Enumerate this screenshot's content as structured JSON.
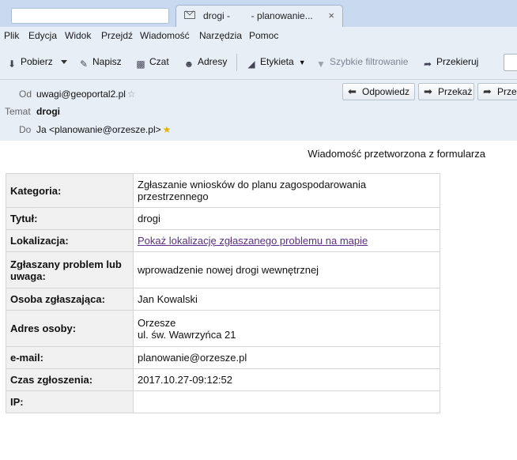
{
  "tab": {
    "title": "drogi -        - planowanie...",
    "close": "×"
  },
  "menu": [
    "Plik",
    "Edycja",
    "Widok",
    "Przejdź",
    "Wiadomość",
    "Narzędzia",
    "Pomoc"
  ],
  "toolbar": {
    "get": "Pobierz",
    "write": "Napisz",
    "chat": "Czat",
    "contacts": "Adresy",
    "tag": "Etykieta",
    "quickfilter": "Szybkie filtrowanie",
    "redirect": "Przekieruj"
  },
  "header": {
    "from_label": "Od",
    "from": "uwagi@geoportal2.pl",
    "subject_label": "Temat",
    "subject": "drogi",
    "to_label": "Do",
    "to": "Ja <planowanie@orzesze.pl>",
    "reply": "Odpowiedz",
    "forward": "Przekaż",
    "more": "Przek"
  },
  "message": {
    "caption": "Wiadomość przetworzona z formularza",
    "rows": [
      {
        "key": "Kategoria:",
        "value": "Zgłaszanie wniosków do planu zagospodarowania przestrzennego"
      },
      {
        "key": "Tytuł:",
        "value": "drogi"
      },
      {
        "key": "Lokalizacja:",
        "value": "Pokaż lokalizację zgłaszanego problemu na mapie",
        "link": true
      },
      {
        "key": "Zgłaszany problem lub uwaga:",
        "value": "wprowadzenie nowej drogi wewnętrznej"
      },
      {
        "key": "Osoba zgłaszająca:",
        "value": "Jan Kowalski"
      },
      {
        "key": "Adres osoby:",
        "value": "Orzesze",
        "value2": "ul. św. Wawrzyńca 21"
      },
      {
        "key": "e-mail:",
        "value": "planowanie@orzesze.pl"
      },
      {
        "key": "Czas zgłoszenia:",
        "value": "2017.10.27-09:12:52"
      },
      {
        "key": "IP:",
        "value": ""
      }
    ]
  }
}
